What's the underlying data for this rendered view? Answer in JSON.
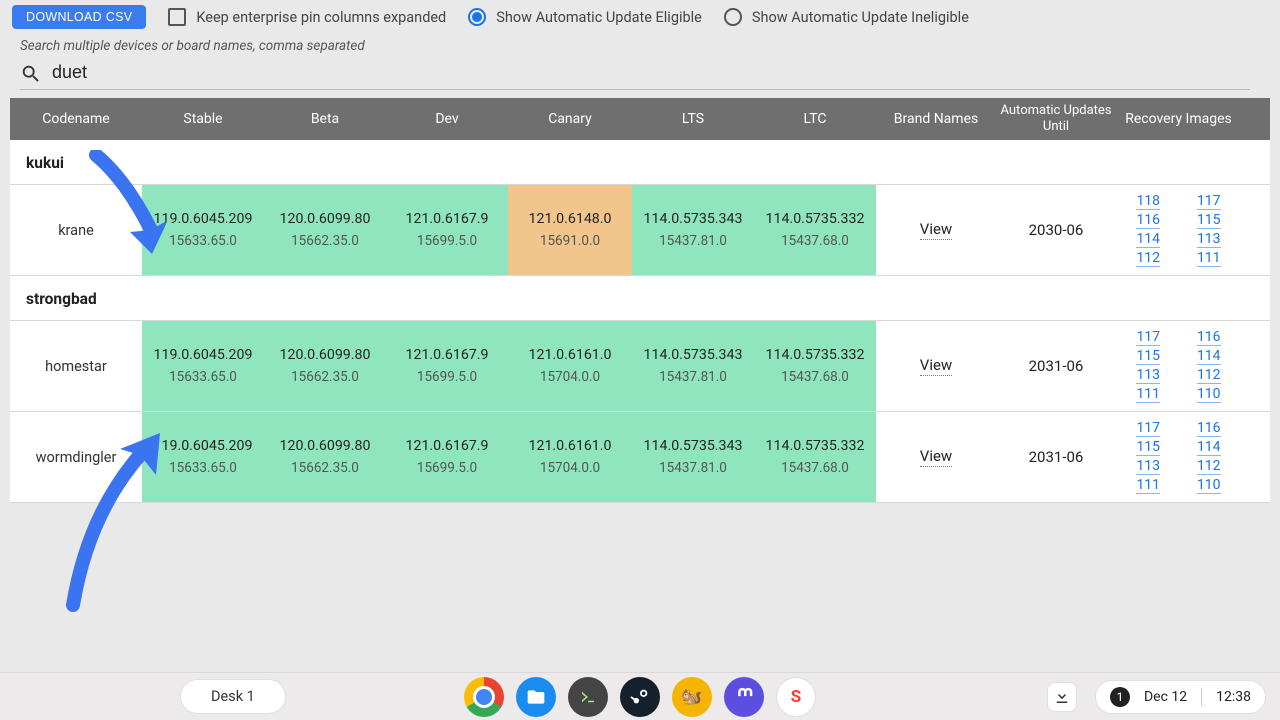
{
  "toolbar": {
    "download_label": "DOWNLOAD CSV",
    "keep_expanded_label": "Keep enterprise pin columns expanded",
    "eligible_label": "Show Automatic Update Eligible",
    "ineligible_label": "Show Automatic Update Ineligible",
    "filter_selected": "eligible"
  },
  "search": {
    "hint": "Search multiple devices or board names, comma separated",
    "value": "duet"
  },
  "columns": [
    "Codename",
    "Stable",
    "Beta",
    "Dev",
    "Canary",
    "LTS",
    "LTC",
    "Brand Names",
    "Automatic Updates Until",
    "Recovery Images"
  ],
  "groups": [
    {
      "name": "kukui",
      "rows": [
        {
          "codename": "krane",
          "stable": {
            "v1": "119.0.6045.209",
            "v2": "15633.65.0",
            "hl": "green"
          },
          "beta": {
            "v1": "120.0.6099.80",
            "v2": "15662.35.0",
            "hl": "green"
          },
          "dev": {
            "v1": "121.0.6167.9",
            "v2": "15699.5.0",
            "hl": "green"
          },
          "canary": {
            "v1": "121.0.6148.0",
            "v2": "15691.0.0",
            "hl": "orange"
          },
          "lts": {
            "v1": "114.0.5735.343",
            "v2": "15437.81.0",
            "hl": "green"
          },
          "ltc": {
            "v1": "114.0.5735.332",
            "v2": "15437.68.0",
            "hl": "green"
          },
          "brand": "View",
          "aue": "2030-06",
          "recovery": [
            "118",
            "117",
            "116",
            "115",
            "114",
            "113",
            "112",
            "111"
          ]
        }
      ]
    },
    {
      "name": "strongbad",
      "rows": [
        {
          "codename": "homestar",
          "stable": {
            "v1": "119.0.6045.209",
            "v2": "15633.65.0",
            "hl": "green"
          },
          "beta": {
            "v1": "120.0.6099.80",
            "v2": "15662.35.0",
            "hl": "green"
          },
          "dev": {
            "v1": "121.0.6167.9",
            "v2": "15699.5.0",
            "hl": "green"
          },
          "canary": {
            "v1": "121.0.6161.0",
            "v2": "15704.0.0",
            "hl": "green"
          },
          "lts": {
            "v1": "114.0.5735.343",
            "v2": "15437.81.0",
            "hl": "green"
          },
          "ltc": {
            "v1": "114.0.5735.332",
            "v2": "15437.68.0",
            "hl": "green"
          },
          "brand": "View",
          "aue": "2031-06",
          "recovery": [
            "117",
            "116",
            "115",
            "114",
            "113",
            "112",
            "111",
            "110"
          ]
        },
        {
          "codename": "wormdingler",
          "stable": {
            "v1": "119.0.6045.209",
            "v2": "15633.65.0",
            "hl": "green"
          },
          "beta": {
            "v1": "120.0.6099.80",
            "v2": "15662.35.0",
            "hl": "green"
          },
          "dev": {
            "v1": "121.0.6167.9",
            "v2": "15699.5.0",
            "hl": "green"
          },
          "canary": {
            "v1": "121.0.6161.0",
            "v2": "15704.0.0",
            "hl": "green"
          },
          "lts": {
            "v1": "114.0.5735.343",
            "v2": "15437.81.0",
            "hl": "green"
          },
          "ltc": {
            "v1": "114.0.5735.332",
            "v2": "15437.68.0",
            "hl": "green"
          },
          "brand": "View",
          "aue": "2031-06",
          "recovery": [
            "117",
            "116",
            "115",
            "114",
            "113",
            "112",
            "111",
            "110"
          ]
        }
      ]
    }
  ],
  "shelf": {
    "desk_label": "Desk 1",
    "notification_count": "1",
    "date": "Dec 12",
    "time": "12:38"
  },
  "annotations": [
    "arrow-to-krane",
    "arrow-to-wormdingler"
  ]
}
